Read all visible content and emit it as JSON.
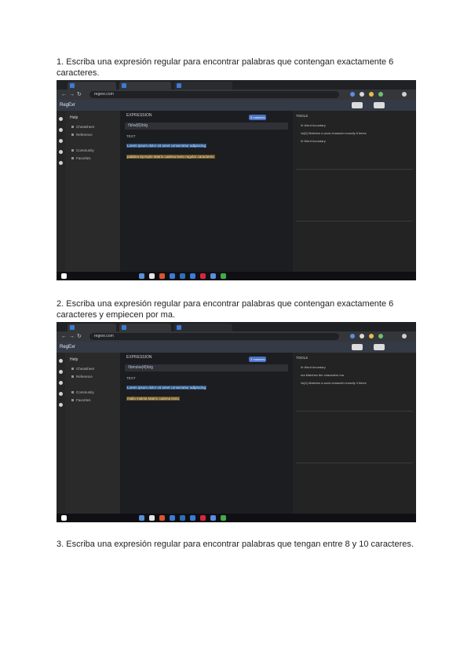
{
  "questions": [
    "1. Escriba una expresión regular para encontrar palabras que contengan exactamente 6 caracteres.",
    "2. Escriba una expresión regular para encontrar palabras que contengan exactamente 6 caracteres y empiecen por ma.",
    "3. Escriba una expresión regular para encontrar palabras que tengan entre 8 y 10 caracteres."
  ],
  "screenshots": [
    {
      "url": "regexr.com",
      "app_title": "RegExr",
      "expression_label": "EXPRESSION",
      "expression": "/\\b\\w{6}\\b/g",
      "text_label": "TEXT",
      "match_info": "8 matches",
      "text_lines": [
        "Lorem ipsum dolor sit amet consectetur adipiscing",
        "palabra Ejemplo Matrix cadena texto regular caracteres"
      ],
      "tools_label": "TOOLS",
      "right_lines": [
        "\\b Word boundary",
        "\\w{6} Matches a word character exactly 6 times",
        "\\b Word boundary"
      ],
      "sidebar_items": [
        "Help",
        "Cheatsheet",
        "Reference",
        "Community",
        "Favorites"
      ]
    },
    {
      "url": "regexr.com",
      "app_title": "RegExr",
      "expression_label": "EXPRESSION",
      "expression": "/\\bma\\w{4}\\b/g",
      "text_label": "TEXT",
      "match_info": "3 matches",
      "text_lines": [
        "Lorem ipsum dolor sit amet consectetur adipiscing",
        "malla maleta Matrix cadena texto"
      ],
      "tools_label": "TOOLS",
      "right_lines": [
        "\\b Word boundary",
        "ma Matches the characters ma",
        "\\w{4} Matches a word character exactly 4 times"
      ],
      "sidebar_items": [
        "Help",
        "Cheatsheet",
        "Reference",
        "Community",
        "Favorites"
      ]
    }
  ]
}
